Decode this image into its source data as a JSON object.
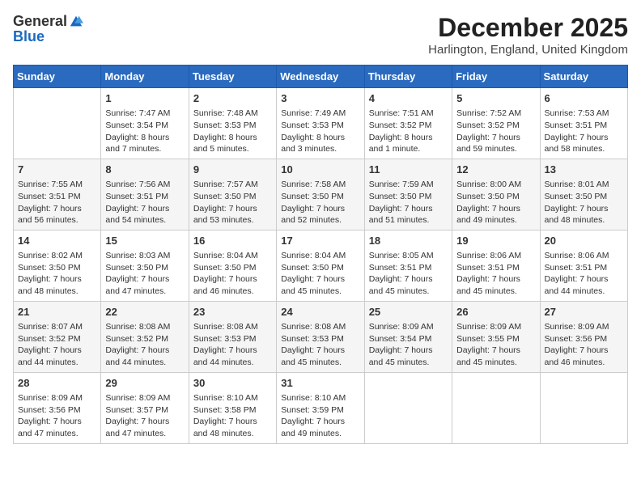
{
  "header": {
    "logo_general": "General",
    "logo_blue": "Blue",
    "month_title": "December 2025",
    "subtitle": "Harlington, England, United Kingdom"
  },
  "weekdays": [
    "Sunday",
    "Monday",
    "Tuesday",
    "Wednesday",
    "Thursday",
    "Friday",
    "Saturday"
  ],
  "rows": [
    [
      {
        "day": "",
        "info": ""
      },
      {
        "day": "1",
        "info": "Sunrise: 7:47 AM\nSunset: 3:54 PM\nDaylight: 8 hours\nand 7 minutes."
      },
      {
        "day": "2",
        "info": "Sunrise: 7:48 AM\nSunset: 3:53 PM\nDaylight: 8 hours\nand 5 minutes."
      },
      {
        "day": "3",
        "info": "Sunrise: 7:49 AM\nSunset: 3:53 PM\nDaylight: 8 hours\nand 3 minutes."
      },
      {
        "day": "4",
        "info": "Sunrise: 7:51 AM\nSunset: 3:52 PM\nDaylight: 8 hours\nand 1 minute."
      },
      {
        "day": "5",
        "info": "Sunrise: 7:52 AM\nSunset: 3:52 PM\nDaylight: 7 hours\nand 59 minutes."
      },
      {
        "day": "6",
        "info": "Sunrise: 7:53 AM\nSunset: 3:51 PM\nDaylight: 7 hours\nand 58 minutes."
      }
    ],
    [
      {
        "day": "7",
        "info": "Sunrise: 7:55 AM\nSunset: 3:51 PM\nDaylight: 7 hours\nand 56 minutes."
      },
      {
        "day": "8",
        "info": "Sunrise: 7:56 AM\nSunset: 3:51 PM\nDaylight: 7 hours\nand 54 minutes."
      },
      {
        "day": "9",
        "info": "Sunrise: 7:57 AM\nSunset: 3:50 PM\nDaylight: 7 hours\nand 53 minutes."
      },
      {
        "day": "10",
        "info": "Sunrise: 7:58 AM\nSunset: 3:50 PM\nDaylight: 7 hours\nand 52 minutes."
      },
      {
        "day": "11",
        "info": "Sunrise: 7:59 AM\nSunset: 3:50 PM\nDaylight: 7 hours\nand 51 minutes."
      },
      {
        "day": "12",
        "info": "Sunrise: 8:00 AM\nSunset: 3:50 PM\nDaylight: 7 hours\nand 49 minutes."
      },
      {
        "day": "13",
        "info": "Sunrise: 8:01 AM\nSunset: 3:50 PM\nDaylight: 7 hours\nand 48 minutes."
      }
    ],
    [
      {
        "day": "14",
        "info": "Sunrise: 8:02 AM\nSunset: 3:50 PM\nDaylight: 7 hours\nand 48 minutes."
      },
      {
        "day": "15",
        "info": "Sunrise: 8:03 AM\nSunset: 3:50 PM\nDaylight: 7 hours\nand 47 minutes."
      },
      {
        "day": "16",
        "info": "Sunrise: 8:04 AM\nSunset: 3:50 PM\nDaylight: 7 hours\nand 46 minutes."
      },
      {
        "day": "17",
        "info": "Sunrise: 8:04 AM\nSunset: 3:50 PM\nDaylight: 7 hours\nand 45 minutes."
      },
      {
        "day": "18",
        "info": "Sunrise: 8:05 AM\nSunset: 3:51 PM\nDaylight: 7 hours\nand 45 minutes."
      },
      {
        "day": "19",
        "info": "Sunrise: 8:06 AM\nSunset: 3:51 PM\nDaylight: 7 hours\nand 45 minutes."
      },
      {
        "day": "20",
        "info": "Sunrise: 8:06 AM\nSunset: 3:51 PM\nDaylight: 7 hours\nand 44 minutes."
      }
    ],
    [
      {
        "day": "21",
        "info": "Sunrise: 8:07 AM\nSunset: 3:52 PM\nDaylight: 7 hours\nand 44 minutes."
      },
      {
        "day": "22",
        "info": "Sunrise: 8:08 AM\nSunset: 3:52 PM\nDaylight: 7 hours\nand 44 minutes."
      },
      {
        "day": "23",
        "info": "Sunrise: 8:08 AM\nSunset: 3:53 PM\nDaylight: 7 hours\nand 44 minutes."
      },
      {
        "day": "24",
        "info": "Sunrise: 8:08 AM\nSunset: 3:53 PM\nDaylight: 7 hours\nand 45 minutes."
      },
      {
        "day": "25",
        "info": "Sunrise: 8:09 AM\nSunset: 3:54 PM\nDaylight: 7 hours\nand 45 minutes."
      },
      {
        "day": "26",
        "info": "Sunrise: 8:09 AM\nSunset: 3:55 PM\nDaylight: 7 hours\nand 45 minutes."
      },
      {
        "day": "27",
        "info": "Sunrise: 8:09 AM\nSunset: 3:56 PM\nDaylight: 7 hours\nand 46 minutes."
      }
    ],
    [
      {
        "day": "28",
        "info": "Sunrise: 8:09 AM\nSunset: 3:56 PM\nDaylight: 7 hours\nand 47 minutes."
      },
      {
        "day": "29",
        "info": "Sunrise: 8:09 AM\nSunset: 3:57 PM\nDaylight: 7 hours\nand 47 minutes."
      },
      {
        "day": "30",
        "info": "Sunrise: 8:10 AM\nSunset: 3:58 PM\nDaylight: 7 hours\nand 48 minutes."
      },
      {
        "day": "31",
        "info": "Sunrise: 8:10 AM\nSunset: 3:59 PM\nDaylight: 7 hours\nand 49 minutes."
      },
      {
        "day": "",
        "info": ""
      },
      {
        "day": "",
        "info": ""
      },
      {
        "day": "",
        "info": ""
      }
    ]
  ]
}
